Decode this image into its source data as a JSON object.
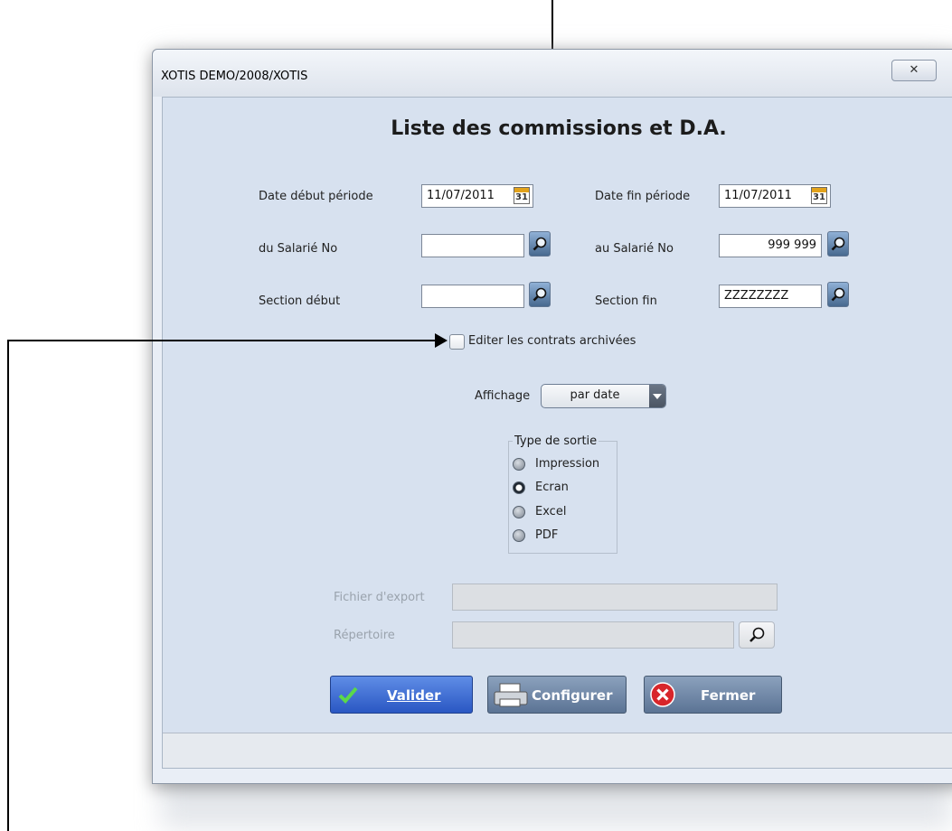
{
  "window": {
    "title": "XOTIS DEMO/2008/XOTIS",
    "close_label": "✕"
  },
  "form": {
    "heading": "Liste des commissions et D.A.",
    "date_debut_label": "Date début période",
    "date_debut_value": "11/07/2011",
    "date_fin_label": "Date fin période",
    "date_fin_value": "11/07/2011",
    "calendar_day": "31",
    "salarie_du_label": "du Salarié No",
    "salarie_du_value": "",
    "salarie_au_label": "au Salarié No",
    "salarie_au_value": "999 999",
    "section_debut_label": "Section début",
    "section_debut_value": "",
    "section_fin_label": "Section fin",
    "section_fin_value": "ZZZZZZZZ",
    "archive_checkbox_label": "Editer les contrats archivées",
    "archive_checked": false,
    "affichage_label": "Affichage",
    "affichage_value": "par date"
  },
  "output_type": {
    "title": "Type de sortie",
    "options": [
      "Impression",
      "Ecran",
      "Excel",
      "PDF"
    ],
    "selected": "Ecran"
  },
  "export": {
    "fichier_label": "Fichier d'export",
    "fichier_value": "",
    "repertoire_label": "Répertoire",
    "repertoire_value": ""
  },
  "buttons": {
    "valider": "Valider",
    "configurer": "Configurer",
    "fermer": "Fermer"
  },
  "colors": {
    "valider": "#2f5fcc",
    "configurer": "#6a82a3",
    "fermer": "#6a82a3",
    "client_bg": "#d7e1ef"
  }
}
